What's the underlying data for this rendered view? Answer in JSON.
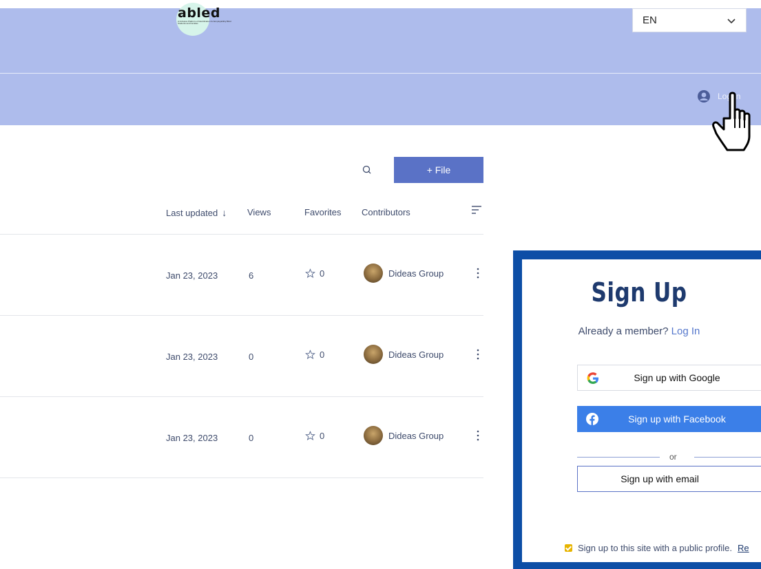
{
  "header": {
    "logo_text": "abled",
    "logo_subtext": "A Inclusive Platform of Identification for Employability Blind Students and Families",
    "language": "EN",
    "login_label": "Log In"
  },
  "toolbar": {
    "file_button_label": "+ File"
  },
  "table": {
    "columns": {
      "last_updated": "Last updated",
      "sort_arrow": "↓",
      "views": "Views",
      "favorites": "Favorites",
      "contributors": "Contributors"
    },
    "rows": [
      {
        "date": "Jan 23, 2023",
        "views": "6",
        "favorites": "0",
        "contributor": "Dideas Group"
      },
      {
        "date": "Jan 23, 2023",
        "views": "0",
        "favorites": "0",
        "contributor": "Dideas Group"
      },
      {
        "date": "Jan 23, 2023",
        "views": "0",
        "favorites": "0",
        "contributor": "Dideas Group"
      }
    ]
  },
  "signup": {
    "title": "Sign Up",
    "member_prompt": "Already a member?",
    "login_link": "Log In",
    "google_label": "Sign up with Google",
    "facebook_label": "Sign up with Facebook",
    "or_text": "or",
    "email_label": "Sign up with email",
    "profile_text": "Sign up to this site with a public profile.",
    "read_more": "Re",
    "profile_checked": true
  },
  "colors": {
    "header_bg": "#aebcec",
    "primary_button": "#5a72c6",
    "modal_frame": "#0d4ea6",
    "facebook_blue": "#3b7fe8",
    "title_navy": "#1e3a6e",
    "checkbox_yellow": "#e7b400"
  },
  "icons": {
    "language_dropdown": "chevron-down-icon",
    "login": "user-circle-icon",
    "cursor": "hand-pointer-icon",
    "search": "search-icon",
    "sort": "sort-lines-icon",
    "favorite": "star-outline-icon",
    "row_menu": "kebab-menu-icon",
    "google": "google-icon",
    "facebook": "facebook-icon"
  }
}
